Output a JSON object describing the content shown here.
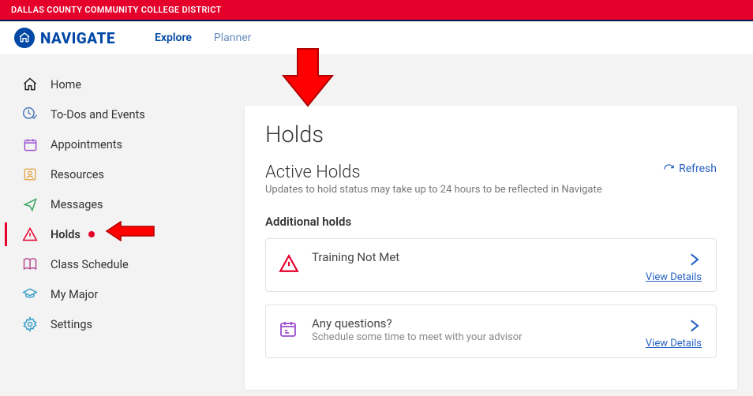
{
  "topbar": {
    "text": "DALLAS COUNTY COMMUNITY COLLEGE DISTRICT"
  },
  "logo": {
    "text": "NAVIGATE"
  },
  "nav": {
    "explore": "Explore",
    "planner": "Planner"
  },
  "sidebar": {
    "items": [
      {
        "label": "Home"
      },
      {
        "label": "To-Dos and Events"
      },
      {
        "label": "Appointments"
      },
      {
        "label": "Resources"
      },
      {
        "label": "Messages"
      },
      {
        "label": "Holds"
      },
      {
        "label": "Class Schedule"
      },
      {
        "label": "My Major"
      },
      {
        "label": "Settings"
      }
    ]
  },
  "page": {
    "title": "Holds",
    "subtitle": "Active Holds",
    "subdesc": "Updates to hold status may take up to 24 hours to be reflected in Navigate",
    "refresh": "Refresh",
    "section": "Additional holds",
    "cards": [
      {
        "title": "Training Not Met",
        "sub": "",
        "link": "View Details"
      },
      {
        "title": "Any questions?",
        "sub": "Schedule some time to meet with your advisor",
        "link": "View Details"
      }
    ]
  },
  "colors": {
    "red": "#e4002b",
    "blue": "#0048a5",
    "link": "#2762c2"
  }
}
